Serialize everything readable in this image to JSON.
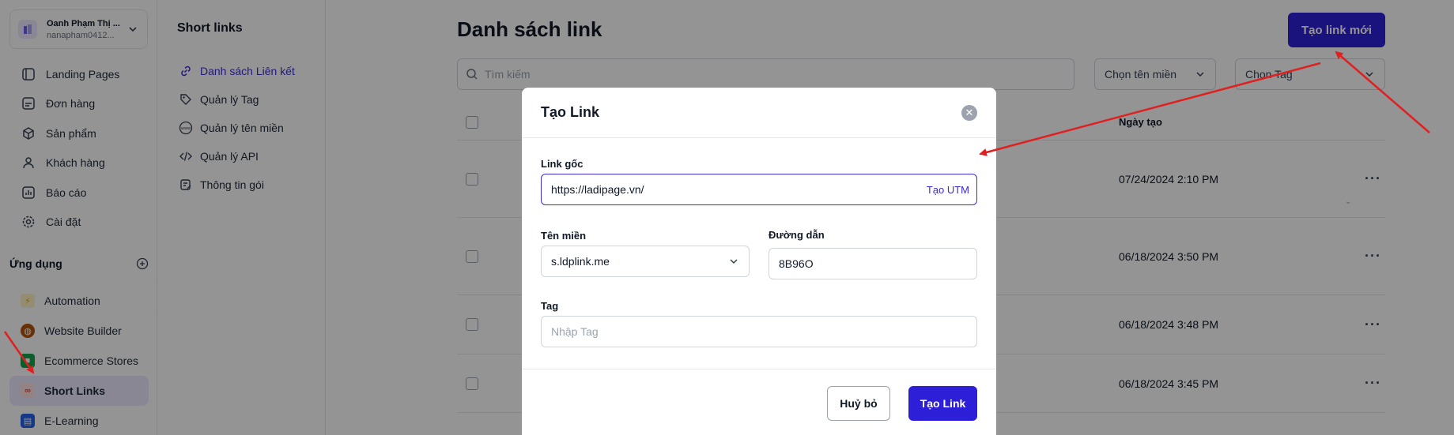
{
  "account": {
    "name": "Oanh Phạm Thị ...",
    "email": "nanapham0412..."
  },
  "nav": {
    "items": [
      {
        "label": "Landing Pages",
        "icon": "landing-pages-icon"
      },
      {
        "label": "Đơn hàng",
        "icon": "orders-icon"
      },
      {
        "label": "Sản phẩm",
        "icon": "products-icon"
      },
      {
        "label": "Khách hàng",
        "icon": "customers-icon"
      },
      {
        "label": "Báo cáo",
        "icon": "reports-icon"
      },
      {
        "label": "Cài đặt",
        "icon": "settings-icon"
      }
    ]
  },
  "apps": {
    "heading": "Ứng dụng",
    "items": [
      {
        "label": "Automation",
        "color": "#f59e0b",
        "glyph": "⚡"
      },
      {
        "label": "Website Builder",
        "color": "#b45309",
        "glyph": "◍"
      },
      {
        "label": "Ecommerce Stores",
        "color": "#16a34a",
        "glyph": "■"
      },
      {
        "label": "Short Links",
        "color": "#ef4444",
        "glyph": "∞"
      },
      {
        "label": "E-Learning",
        "color": "#2563eb",
        "glyph": "▤"
      }
    ]
  },
  "subnav": {
    "title": "Short links",
    "items": [
      {
        "label": "Danh sách Liên kết",
        "icon": "link-icon"
      },
      {
        "label": "Quản lý Tag",
        "icon": "tag-icon"
      },
      {
        "label": "Quản lý tên miền",
        "icon": "www-icon"
      },
      {
        "label": "Quản lý API",
        "icon": "code-icon"
      },
      {
        "label": "Thông tin gói",
        "icon": "plan-icon"
      }
    ]
  },
  "main": {
    "title": "Danh sách link",
    "new_button": "Tạo link mới",
    "search_placeholder": "Tìm kiếm",
    "domain_filter": "Chọn tên miền",
    "tag_filter": "Chọn Tag",
    "date_header": "Ngày tạo",
    "rows": [
      {
        "date": "07/24/2024 2:10 PM"
      },
      {
        "date": "06/18/2024 3:50 PM"
      },
      {
        "date": "06/18/2024 3:48 PM"
      },
      {
        "date": "06/18/2024 3:45 PM"
      }
    ]
  },
  "modal": {
    "title": "Tạo Link",
    "original_link_label": "Link gốc",
    "original_link_value": "https://ladipage.vn/",
    "utm_label": "Tạo UTM",
    "domain_label": "Tên miền",
    "domain_value": "s.ldplink.me",
    "path_label": "Đường dẫn",
    "path_value": "8B96O",
    "tag_label": "Tag",
    "tag_placeholder": "Nhập Tag",
    "cancel_label": "Huỷ bỏ",
    "create_label": "Tạo Link"
  },
  "colors": {
    "accent": "#2d1fd8",
    "annotation": "#e02020"
  }
}
